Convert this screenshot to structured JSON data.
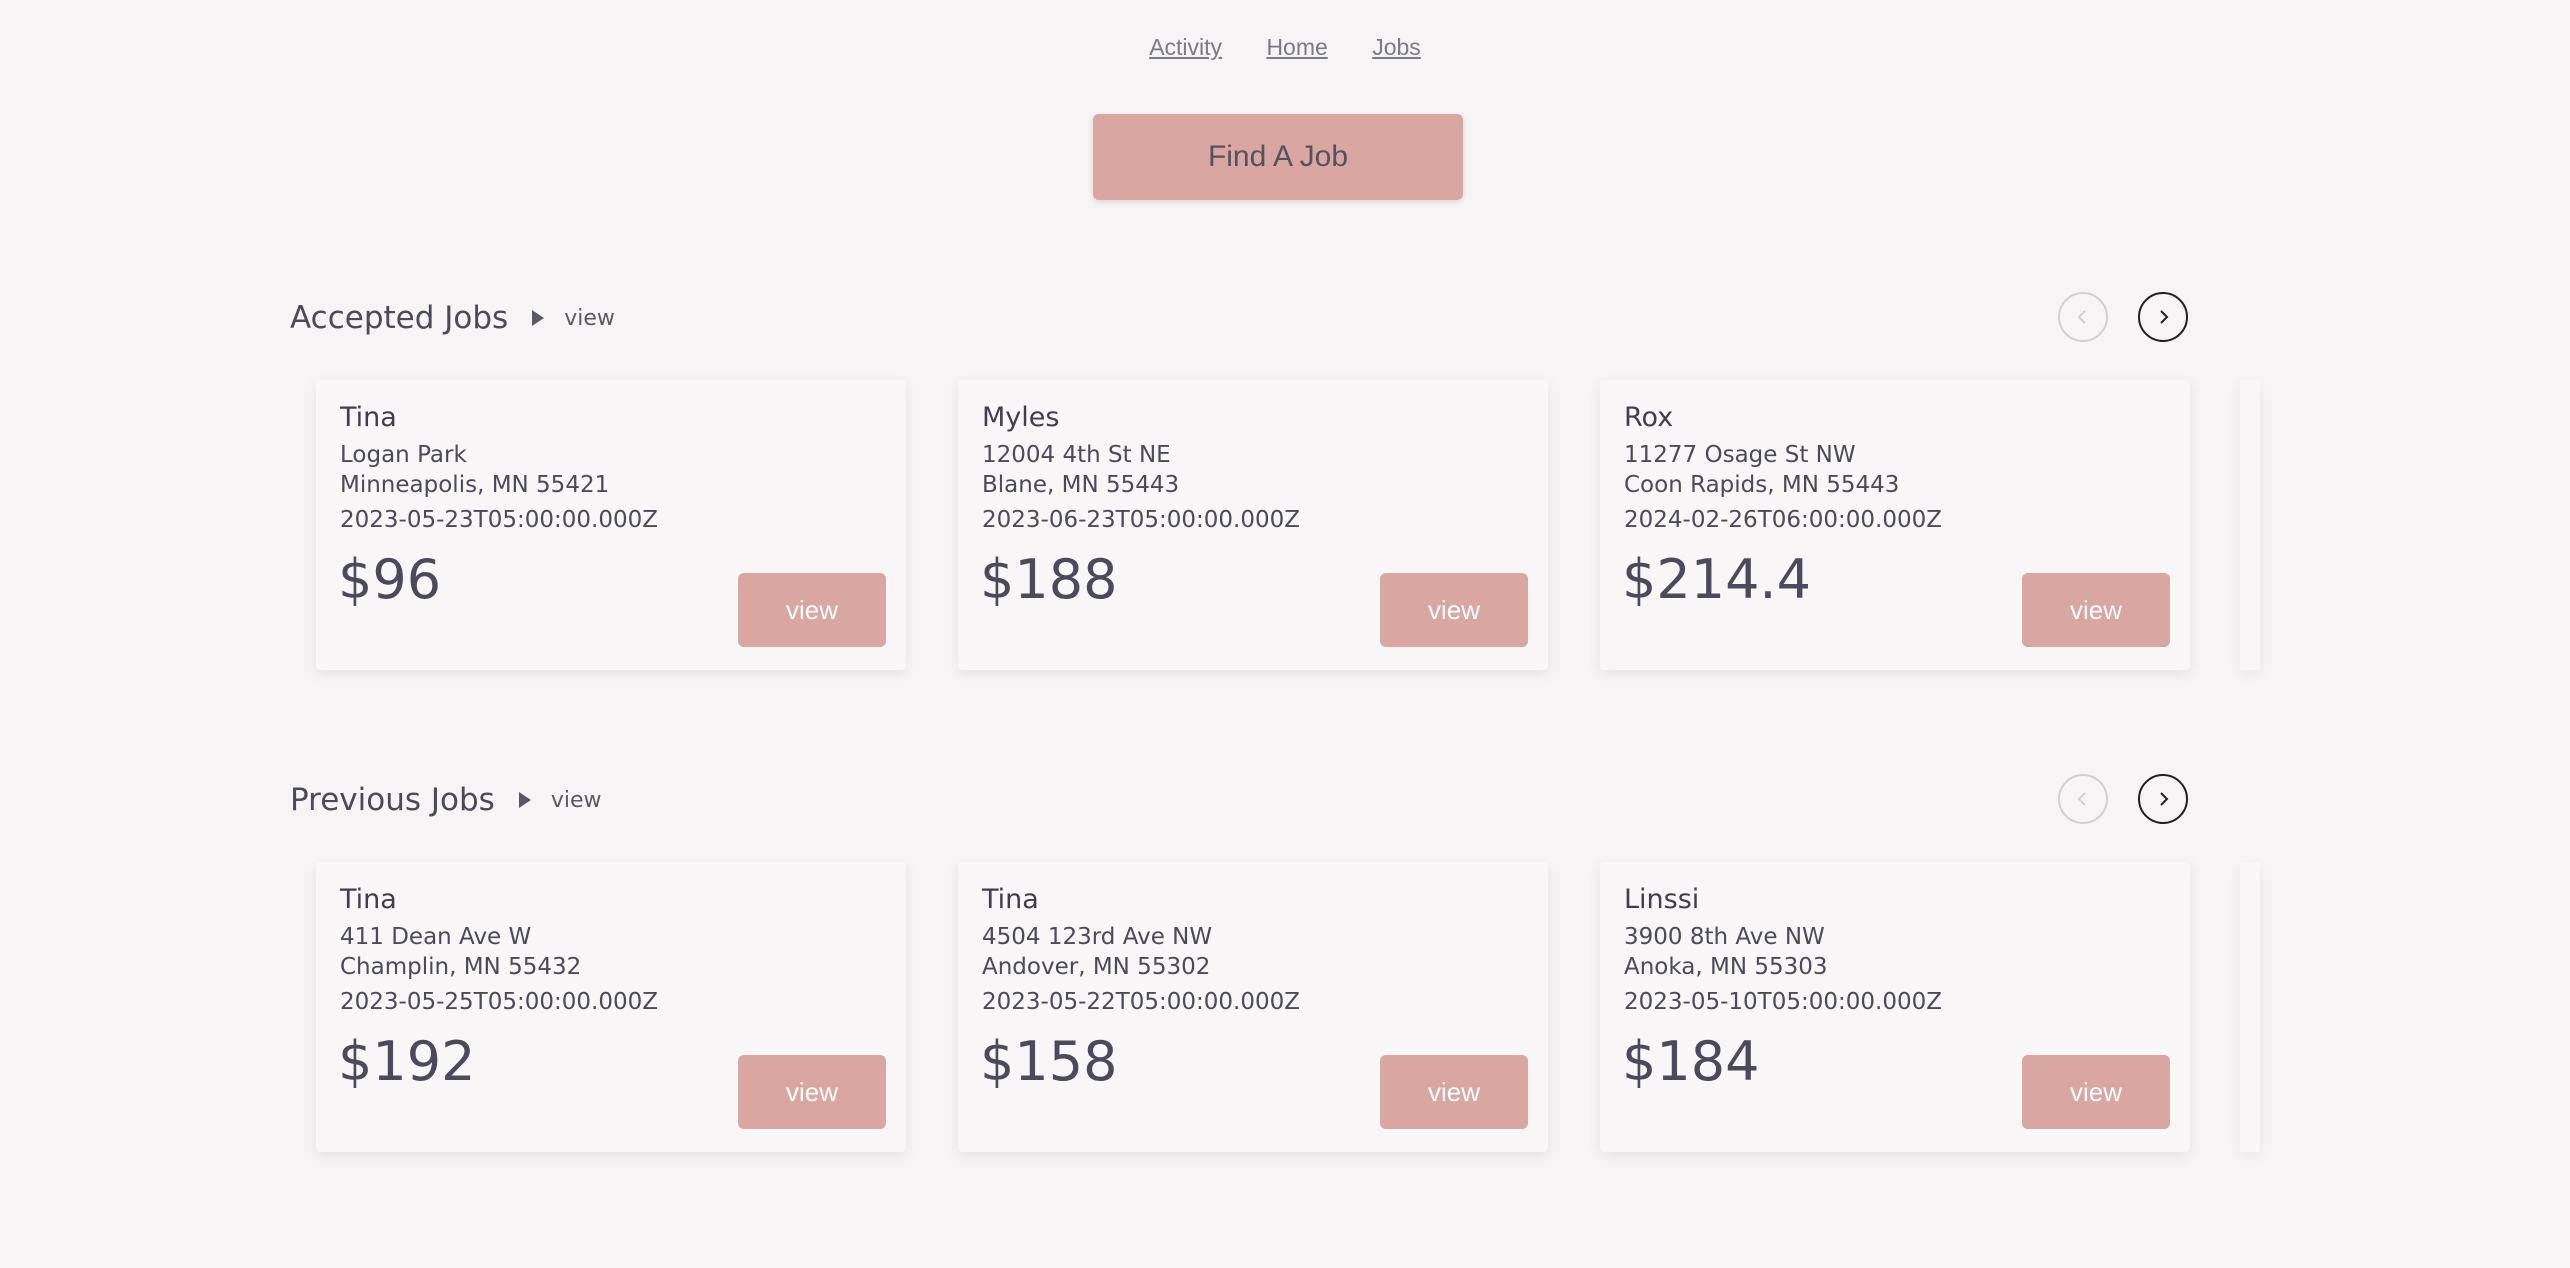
{
  "nav": {
    "links": [
      {
        "label": "Activity"
      },
      {
        "label": "Home"
      },
      {
        "label": "Jobs"
      }
    ]
  },
  "find_job_label": "Find A Job",
  "sections": [
    {
      "title": "Accepted Jobs",
      "view_label": "view",
      "cards": [
        {
          "name": "Tina",
          "address1": "Logan Park",
          "address2": "Minneapolis, MN 55421",
          "date": "2023-05-23T05:00:00.000Z",
          "price": "$96",
          "view_label": "view"
        },
        {
          "name": "Myles",
          "address1": "12004 4th St NE",
          "address2": "Blane, MN 55443",
          "date": "2023-06-23T05:00:00.000Z",
          "price": "$188",
          "view_label": "view"
        },
        {
          "name": "Rox",
          "address1": "11277 Osage St NW",
          "address2": "Coon Rapids, MN 55443",
          "date": "2024-02-26T06:00:00.000Z",
          "price": "$214.4",
          "view_label": "view"
        }
      ]
    },
    {
      "title": "Previous Jobs",
      "view_label": "view",
      "cards": [
        {
          "name": "Tina",
          "address1": "411 Dean Ave W",
          "address2": "Champlin, MN 55432",
          "date": "2023-05-25T05:00:00.000Z",
          "price": "$192",
          "view_label": "view"
        },
        {
          "name": "Tina",
          "address1": "4504 123rd Ave NW",
          "address2": "Andover, MN 55302",
          "date": "2023-05-22T05:00:00.000Z",
          "price": "$158",
          "view_label": "view"
        },
        {
          "name": "Linssi",
          "address1": "3900 8th Ave NW",
          "address2": "Anoka, MN 55303",
          "date": "2023-05-10T05:00:00.000Z",
          "price": "$184",
          "view_label": "view"
        }
      ]
    }
  ],
  "colors": {
    "accent": "#d9a6a1",
    "background": "#f7f4f5",
    "text": "#4b4a57"
  }
}
